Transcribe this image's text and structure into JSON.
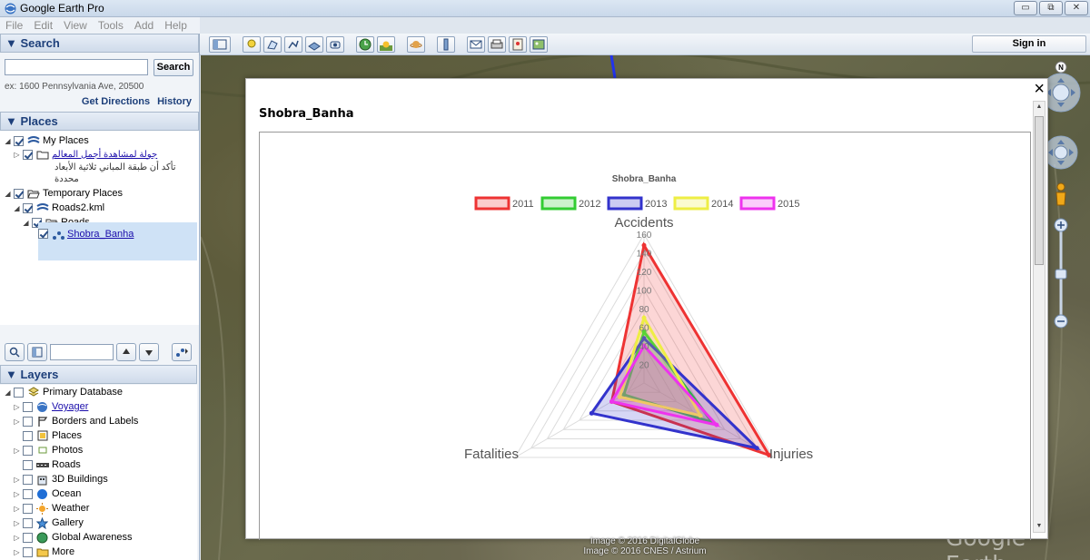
{
  "window": {
    "title": "Google Earth Pro",
    "min_glyph": "▭",
    "restore_glyph": "⧉",
    "close_glyph": "✕"
  },
  "menu": [
    "File",
    "Edit",
    "View",
    "Tools",
    "Add",
    "Help"
  ],
  "toolbar": {
    "sign_in": "Sign in"
  },
  "search": {
    "header": "▼ Search",
    "button": "Search",
    "hint": "ex: 1600 Pennsylvania Ave, 20500",
    "get_directions": "Get Directions",
    "history": "History"
  },
  "places": {
    "header": "▼ Places",
    "my_places": "My Places",
    "tour_link": "جولة لمشاهدة أجمل المعالم",
    "tour_desc": "تأكد أن طبقة المباني ثلاثية الأبعاد",
    "tour_desc2": "محددة",
    "temporary": "Temporary Places",
    "kml": "Roads2.kml",
    "roads": "Roads",
    "selected": "Shobra_Banha"
  },
  "layers": {
    "header": "▼ Layers",
    "items": [
      "Primary Database",
      "Voyager",
      "Borders and Labels",
      "Places",
      "Photos",
      "Roads",
      "3D Buildings",
      "Ocean",
      "Weather",
      "Gallery",
      "Global Awareness",
      "More"
    ]
  },
  "balloon": {
    "title": "Shobra_Banha",
    "close": "×"
  },
  "chart_data": {
    "type": "radar",
    "title": "Shobra_Banha",
    "axes": [
      "Accidents",
      "Injuries",
      "Fatalities"
    ],
    "r_ticks": [
      "20",
      "40",
      "60",
      "80",
      "100",
      "120",
      "140",
      "160"
    ],
    "r_max": 160,
    "legend_position": "top",
    "series": [
      {
        "name": "2011",
        "color": "#ee3333",
        "values": [
          148,
          155,
          40
        ]
      },
      {
        "name": "2012",
        "color": "#33cc33",
        "values": [
          55,
          85,
          25
        ]
      },
      {
        "name": "2013",
        "color": "#3333cc",
        "values": [
          48,
          140,
          65
        ]
      },
      {
        "name": "2014",
        "color": "#eeee44",
        "values": [
          70,
          70,
          30
        ]
      },
      {
        "name": "2015",
        "color": "#ee33ee",
        "values": [
          40,
          90,
          40
        ]
      }
    ]
  },
  "nav": {
    "north": "N"
  },
  "credits": {
    "line1": "Image © 2016 DigitalGlobe",
    "line2": "Image © 2016 CNES / Astrium",
    "watermark": "Google Earth"
  }
}
